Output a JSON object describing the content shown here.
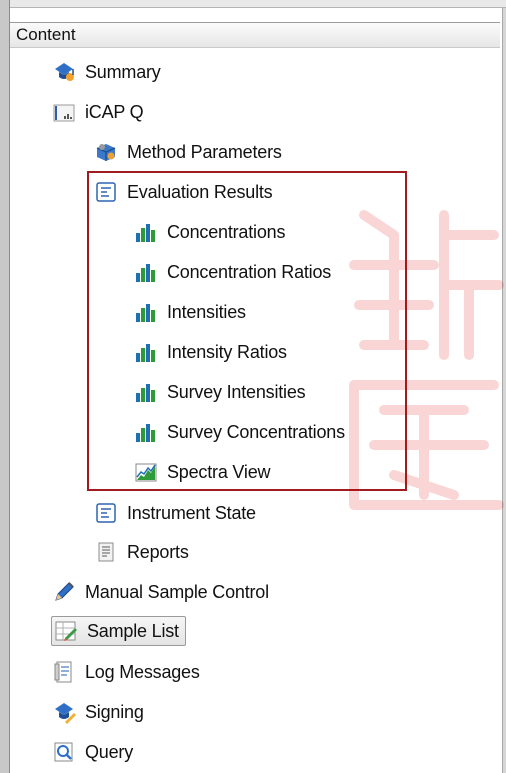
{
  "panel": {
    "header": "Content"
  },
  "tree": {
    "summary": "Summary",
    "instrument": "iCAP Q",
    "method_parameters": "Method Parameters",
    "evaluation_results": "Evaluation Results",
    "concentrations": "Concentrations",
    "concentration_ratios": "Concentration Ratios",
    "intensities": "Intensities",
    "intensity_ratios": "Intensity Ratios",
    "survey_intensities": "Survey Intensities",
    "survey_concentrations": "Survey Concentrations",
    "spectra_view": "Spectra View",
    "instrument_state": "Instrument State",
    "reports": "Reports",
    "manual_sample_control": "Manual Sample Control",
    "sample_list": "Sample List",
    "log_messages": "Log Messages",
    "signing": "Signing",
    "query": "Query"
  },
  "selected_item": "Sample List",
  "highlight_box_color": "#a01c20",
  "icons": {
    "summary": "summary-icon",
    "instrument": "instrument-icon",
    "method_parameters": "method-parameters-icon",
    "evaluation_results": "evaluation-results-icon",
    "chart": "bar-chart-icon",
    "spectra_view": "spectra-view-icon",
    "instrument_state": "instrument-state-icon",
    "reports": "reports-icon",
    "manual_sample_control": "pencil-icon",
    "sample_list": "sample-list-icon",
    "log_messages": "log-messages-icon",
    "signing": "signing-icon",
    "query": "query-icon"
  }
}
